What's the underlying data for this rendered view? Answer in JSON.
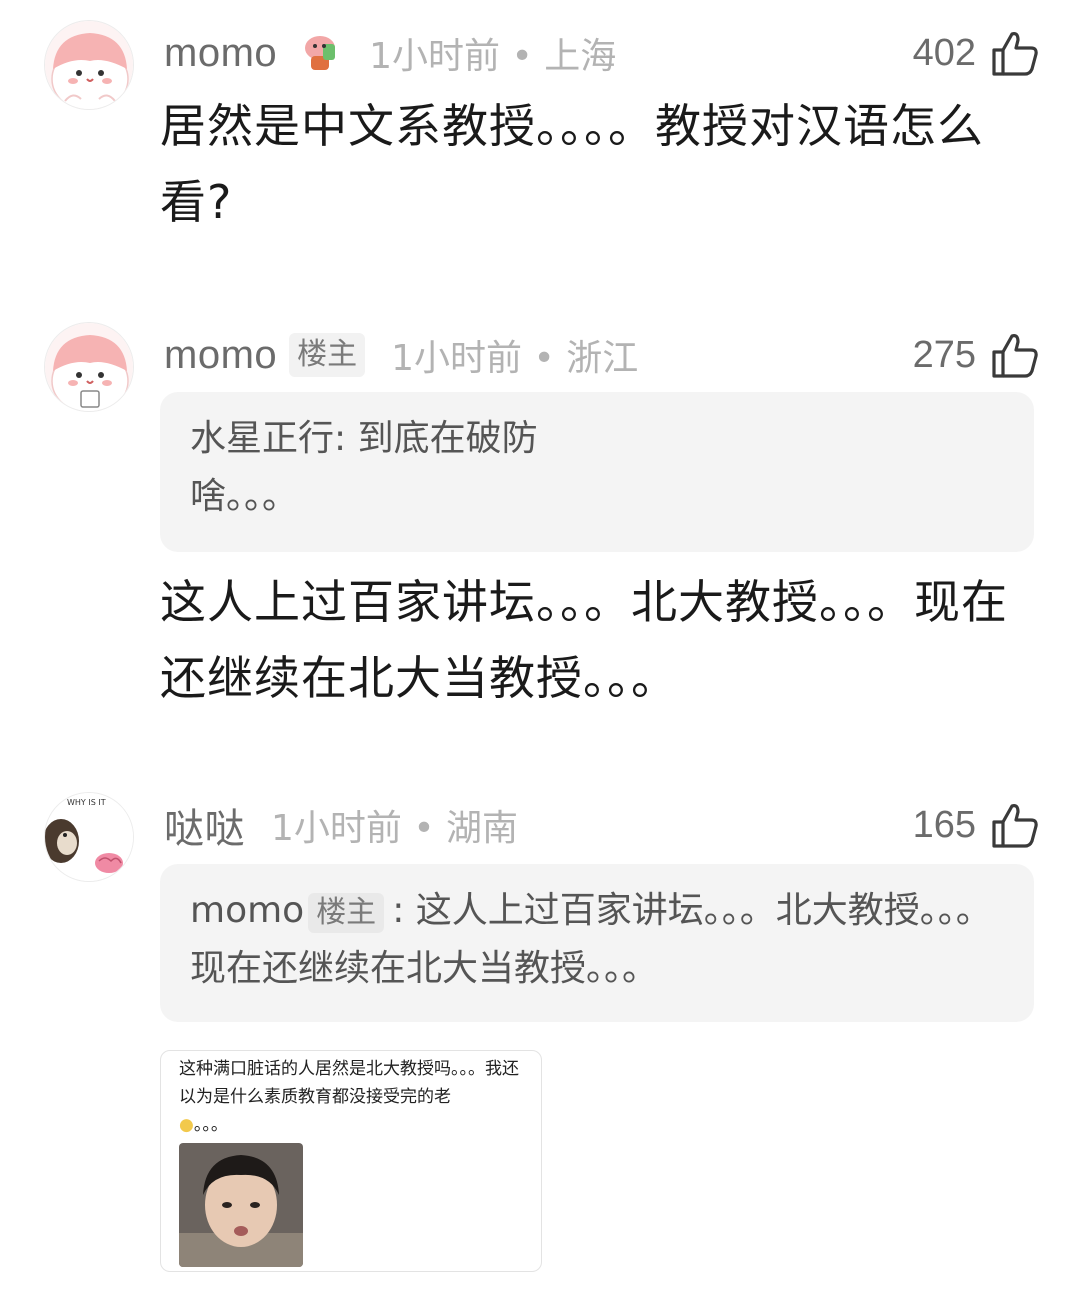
{
  "comments": [
    {
      "username": "momo",
      "time": "1小时前",
      "location": "上海",
      "likes": "402",
      "text": "居然是中文系教授。。。。教授对汉语怎么看?"
    },
    {
      "username": "momo",
      "op_badge": "楼主",
      "time": "1小时前",
      "location": "浙江",
      "likes": "275",
      "quote_author": "水星正行",
      "quote_text": "到底在破防啥。。。",
      "text": "这人上过百家讲坛。。。北大教授。。。现在还继续在北大当教授。。。"
    },
    {
      "username": "哒哒",
      "time": "1小时前",
      "location": "湖南",
      "likes": "165",
      "quote_author": "momo",
      "quote_badge": "楼主",
      "quote_text": "这人上过百家讲坛。。。北大教授。。。现在还继续在北大当教授。。。",
      "avatar_caption": "WHY IS IT",
      "image": {
        "text": "这种满口脏话的人居然是北大教授吗。。。我还以为是什么素质教育都没接受完的老",
        "suffix": "。。。",
        "icon": "lightbulb-icon"
      }
    }
  ],
  "separator": "•",
  "colon": ": ",
  "icons": {
    "like": "thumbs-up-icon"
  },
  "colors": {
    "username": "#6b6b6b",
    "meta": "#b3b3b3",
    "quote_bg": "#f4f4f4",
    "avatar_pink": "#f7b8b8"
  }
}
